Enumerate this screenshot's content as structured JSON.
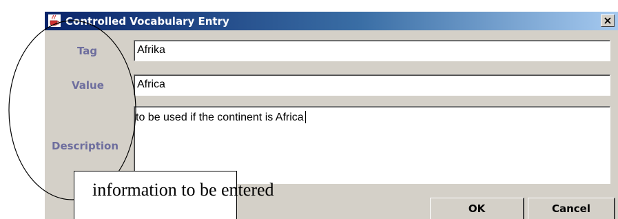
{
  "window": {
    "title": "Controlled Vocabulary Entry",
    "close_icon": "close-icon",
    "app_icon": "java-cup-icon",
    "title_gradient_start": "#0a246a",
    "title_gradient_end": "#a6caf0"
  },
  "form": {
    "tag_label": "Tag",
    "tag_value": "Afrika",
    "value_label": "Value",
    "value_value": "Africa",
    "description_label": "Description",
    "description_value": "to be used if the continent is Africa",
    "label_color": "#6e6e9e"
  },
  "buttons": {
    "ok_label": "OK",
    "cancel_label": "Cancel"
  },
  "annotation": {
    "callout_text": "information to be entered"
  }
}
